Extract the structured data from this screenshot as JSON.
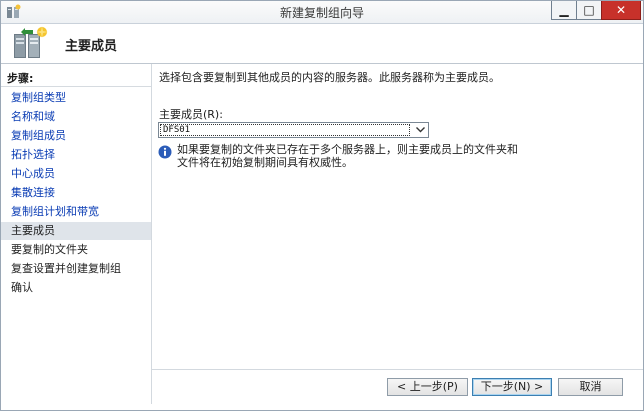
{
  "window": {
    "title": "新建复制组向导",
    "minimize_glyph": "▁",
    "maximize_glyph": "□",
    "close_glyph": "✕"
  },
  "header": {
    "title": "主要成员",
    "icon": "replication-group-server-icon"
  },
  "sidebar": {
    "heading": "步骤:",
    "current_index": 8,
    "items": [
      {
        "label": "复制组类型",
        "state": "completed"
      },
      {
        "label": "名称和域",
        "state": "completed"
      },
      {
        "label": "复制组成员",
        "state": "completed"
      },
      {
        "label": "拓扑选择",
        "state": "completed"
      },
      {
        "label": "中心成员",
        "state": "completed"
      },
      {
        "label": "集散连接",
        "state": "completed"
      },
      {
        "label": "复制组计划和带宽",
        "state": "completed"
      },
      {
        "label": "主要成员",
        "state": "current"
      },
      {
        "label": "要复制的文件夹",
        "state": "upcoming"
      },
      {
        "label": "复查设置并创建复制组",
        "state": "upcoming"
      },
      {
        "label": "确认",
        "state": "upcoming"
      }
    ]
  },
  "main": {
    "intro": "选择包含要复制到其他成员的内容的服务器。此服务器称为主要成员。",
    "primary_member_label": "主要成员(R):",
    "primary_member_value": "DFS01",
    "info_line_1": "如果要复制的文件夹已存在于多个服务器上，则主要成员上的文件夹和",
    "info_line_2": "文件将在初始复制期间具有权威性。"
  },
  "footer": {
    "back_label": "< 上一步(P)",
    "next_label": "下一步(N) >",
    "cancel_label": "取消"
  },
  "colors": {
    "link": "#0a3cb4",
    "current_step_bg": "#dfe4ea",
    "close_button": "#c7312a",
    "info_icon": "#2b5cb8"
  }
}
